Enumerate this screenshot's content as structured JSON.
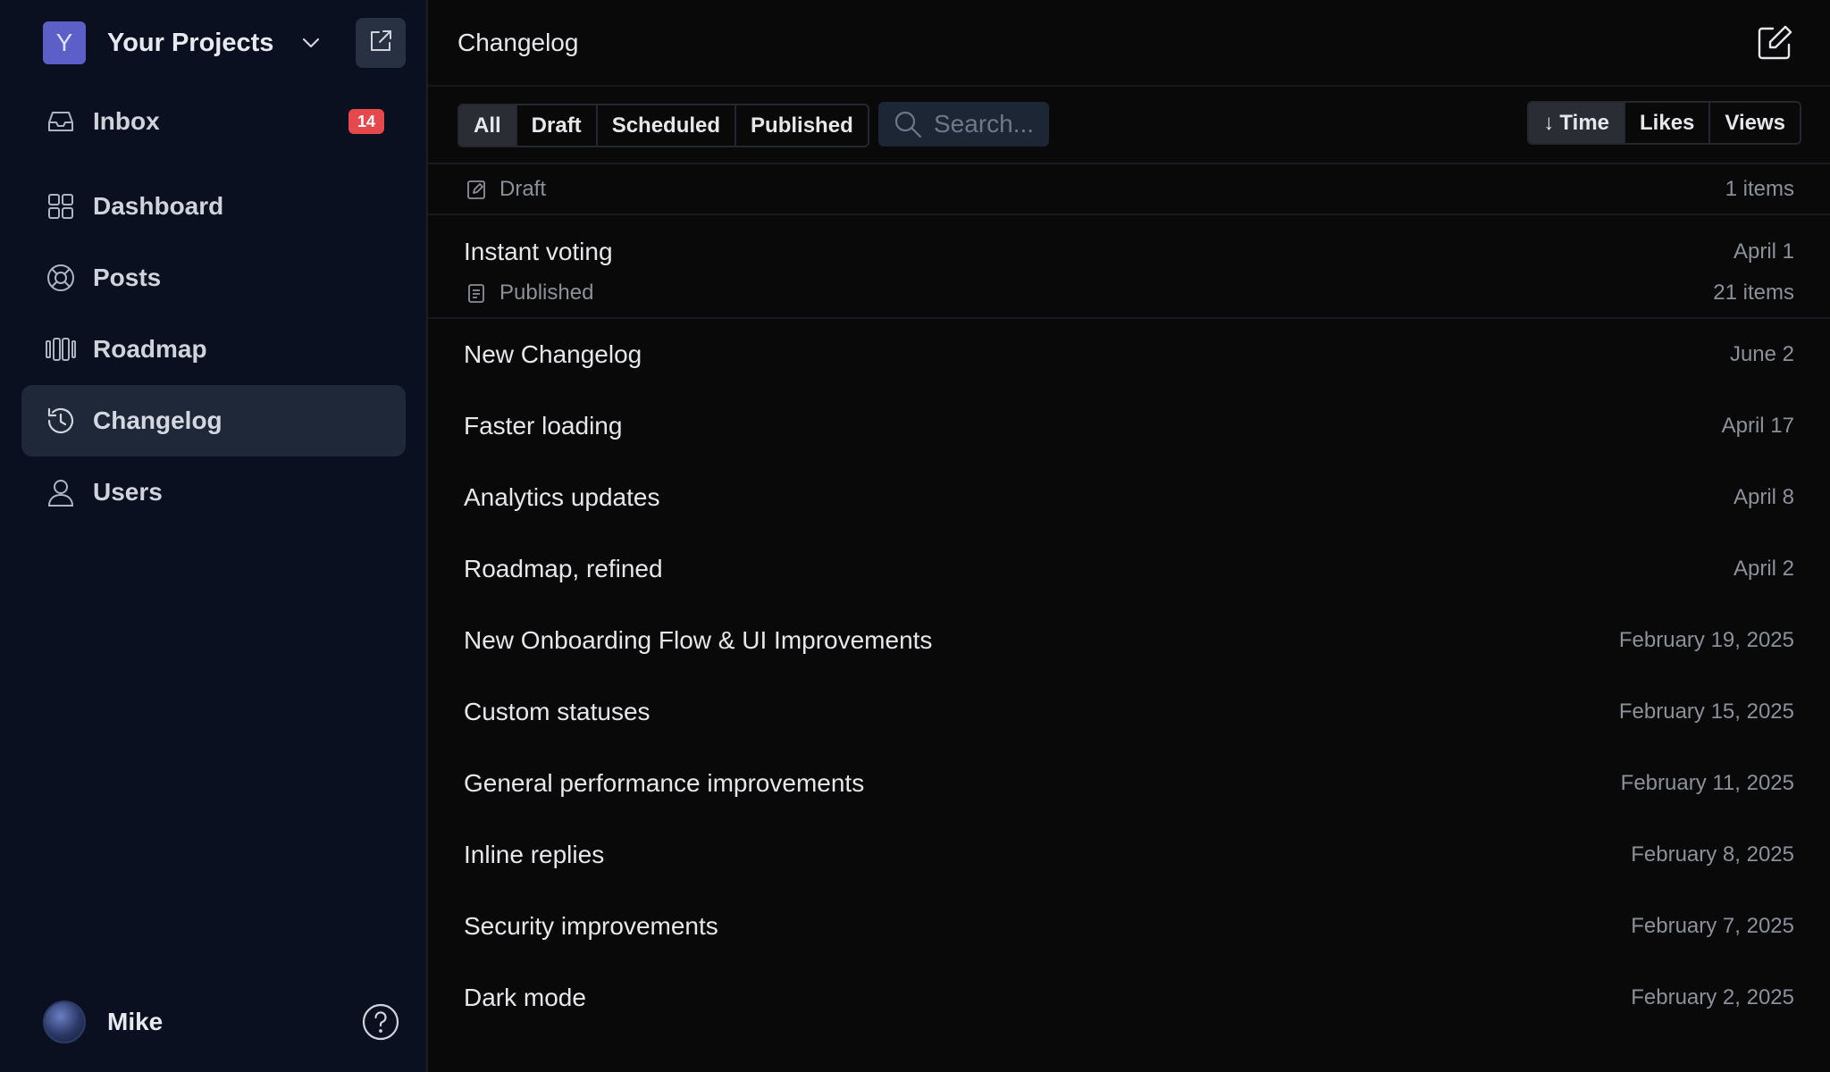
{
  "sidebar": {
    "project": {
      "initial": "Y",
      "name": "Your Projects"
    },
    "nav": [
      {
        "key": "inbox",
        "label": "Inbox",
        "badge": "14"
      },
      {
        "key": "dashboard",
        "label": "Dashboard"
      },
      {
        "key": "posts",
        "label": "Posts"
      },
      {
        "key": "roadmap",
        "label": "Roadmap"
      },
      {
        "key": "changelog",
        "label": "Changelog",
        "active": true
      },
      {
        "key": "users",
        "label": "Users"
      }
    ],
    "user": {
      "name": "Mike"
    }
  },
  "header": {
    "title": "Changelog"
  },
  "filters": {
    "status": [
      "All",
      "Draft",
      "Scheduled",
      "Published"
    ],
    "selected_status": "All",
    "search_placeholder": "Search...",
    "sort": [
      "Time",
      "Likes",
      "Views"
    ],
    "selected_sort": "Time"
  },
  "groups": [
    {
      "name": "Draft",
      "count": "1 items",
      "items": [
        {
          "title": "Instant voting",
          "date": "April 1"
        }
      ]
    },
    {
      "name": "Published",
      "count": "21 items",
      "items": [
        {
          "title": "New Changelog",
          "date": "June 2"
        },
        {
          "title": "Faster loading",
          "date": "April 17"
        },
        {
          "title": "Analytics updates",
          "date": "April 8"
        },
        {
          "title": "Roadmap, refined",
          "date": "April 2"
        },
        {
          "title": "New Onboarding Flow & UI Improvements",
          "date": "February 19, 2025"
        },
        {
          "title": "Custom statuses",
          "date": "February 15, 2025"
        },
        {
          "title": "General performance improvements",
          "date": "February 11, 2025"
        },
        {
          "title": "Inline replies",
          "date": "February 8, 2025"
        },
        {
          "title": "Security improvements",
          "date": "February 7, 2025"
        },
        {
          "title": "Dark mode",
          "date": "February 2, 2025"
        }
      ]
    }
  ],
  "colors": {
    "sidebar_bg": "#0a1020",
    "main_bg": "#09090a",
    "active_nav_bg": "#1f2838",
    "badge_red": "#e5484d",
    "project_badge": "#5b5fc7",
    "search_bg": "#1d2635"
  }
}
